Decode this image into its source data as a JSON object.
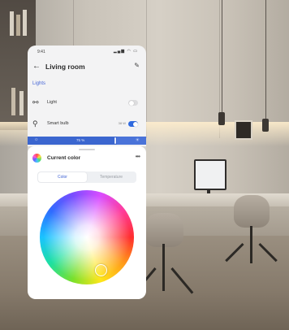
{
  "status_bar": {
    "time": "9:41",
    "icons": "▂▄▆ ◠ ▭"
  },
  "nav": {
    "title": "Living room",
    "back_icon": "back-arrow-icon",
    "edit_icon": "pencil-icon"
  },
  "section": {
    "label": "Lights"
  },
  "devices": [
    {
      "label": "Light",
      "icon": "bulb-icon",
      "on": false
    },
    {
      "label": "Smart bulb",
      "icon": "bulb-icon",
      "value": "38 W",
      "on": true
    }
  ],
  "brightness": {
    "percent_label": "75 %",
    "level": 0.75
  },
  "sheet": {
    "title": "Current color",
    "more_icon": "ellipsis-icon",
    "tabs": [
      {
        "label": "Color",
        "active": true
      },
      {
        "label": "Temperature",
        "active": false
      }
    ]
  },
  "colors": {
    "accent": "#3f62d4",
    "toggle_on": "#2f6ae0",
    "brightness_bar": "#4a73d9"
  }
}
